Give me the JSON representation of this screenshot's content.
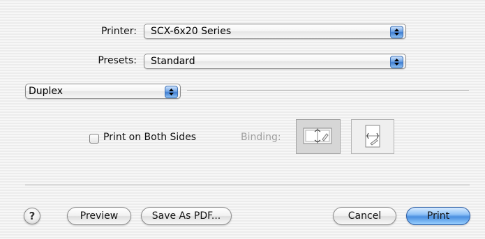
{
  "printer": {
    "label": "Printer:",
    "value": "SCX-6x20 Series"
  },
  "presets": {
    "label": "Presets:",
    "value": "Standard"
  },
  "panel": {
    "value": "Duplex"
  },
  "duplex": {
    "checkbox_label": "Print on Both Sides",
    "checked": false,
    "binding_label": "Binding:"
  },
  "buttons": {
    "help": "?",
    "preview": "Preview",
    "save_pdf": "Save As PDF...",
    "cancel": "Cancel",
    "print": "Print"
  },
  "icons": {
    "popup_arrow": "up-down-chevron-icon",
    "binding_long": "binding-long-edge-icon",
    "binding_short": "binding-short-edge-icon"
  },
  "colors": {
    "accent": "#4a8fe0",
    "background": "#ececec"
  }
}
